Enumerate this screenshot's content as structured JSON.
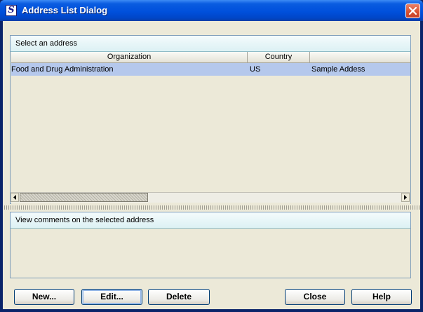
{
  "window": {
    "title": "Address List Dialog",
    "icon_letter": "S",
    "close_icon": "close-x-icon"
  },
  "addresses": {
    "header": "Select an address",
    "columns": [
      "Organization",
      "Country",
      ""
    ],
    "rows": [
      {
        "organization": "Food and Drug Administration",
        "country": "US",
        "address": "Sample Addess"
      }
    ]
  },
  "comments": {
    "header": "View comments on the selected address"
  },
  "buttons": {
    "new": "New...",
    "edit": "Edit...",
    "delete": "Delete",
    "close": "Close",
    "help": "Help"
  },
  "colors": {
    "title_bar": "#0050dc",
    "selection": "#b5c8ec",
    "panel_header": "#dcf1f4",
    "close_button": "#d8502e"
  }
}
